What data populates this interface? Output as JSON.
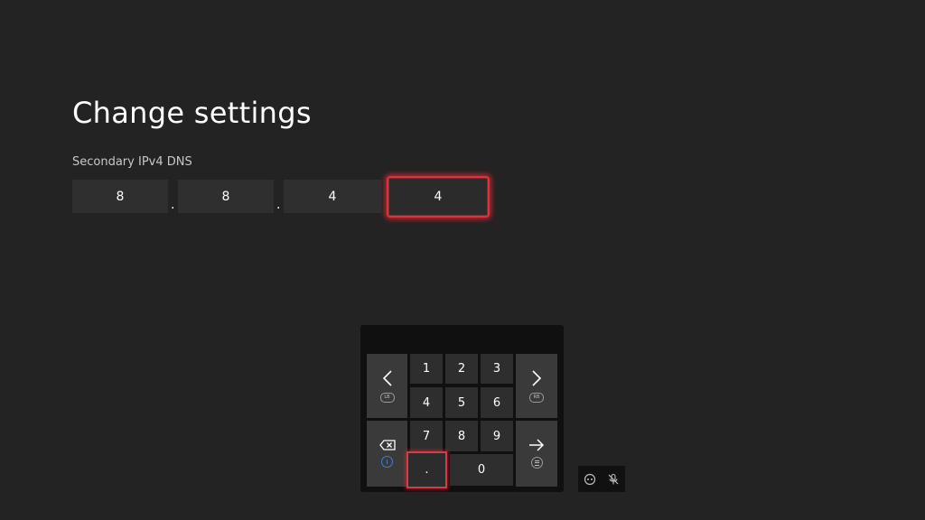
{
  "page": {
    "title": "Change settings",
    "field_label": "Secondary IPv4 DNS"
  },
  "ip": {
    "octets": [
      "8",
      "8",
      "4",
      "4"
    ],
    "separator": ".",
    "focused_octet": 4
  },
  "keyboard": {
    "keys": {
      "k1": "1",
      "k2": "2",
      "k3": "3",
      "k4": "4",
      "k5": "5",
      "k6": "6",
      "k7": "7",
      "k8": "8",
      "k9": "9",
      "dot": ".",
      "k0": "0"
    },
    "hints": {
      "left": "LB",
      "right": "RB"
    },
    "focused_key": "."
  },
  "icons": {
    "left": "chevron-left-icon",
    "right": "chevron-right-icon",
    "backspace": "backspace-icon",
    "enter": "arrow-right-icon",
    "x_button": "x-button-icon",
    "menu_button": "menu-button-icon",
    "chat": "chat-icon",
    "mic_off": "mic-off-icon"
  },
  "colors": {
    "background": "#232323",
    "focus": "#e0303a",
    "xbox_x_blue": "#3b7fd4"
  }
}
